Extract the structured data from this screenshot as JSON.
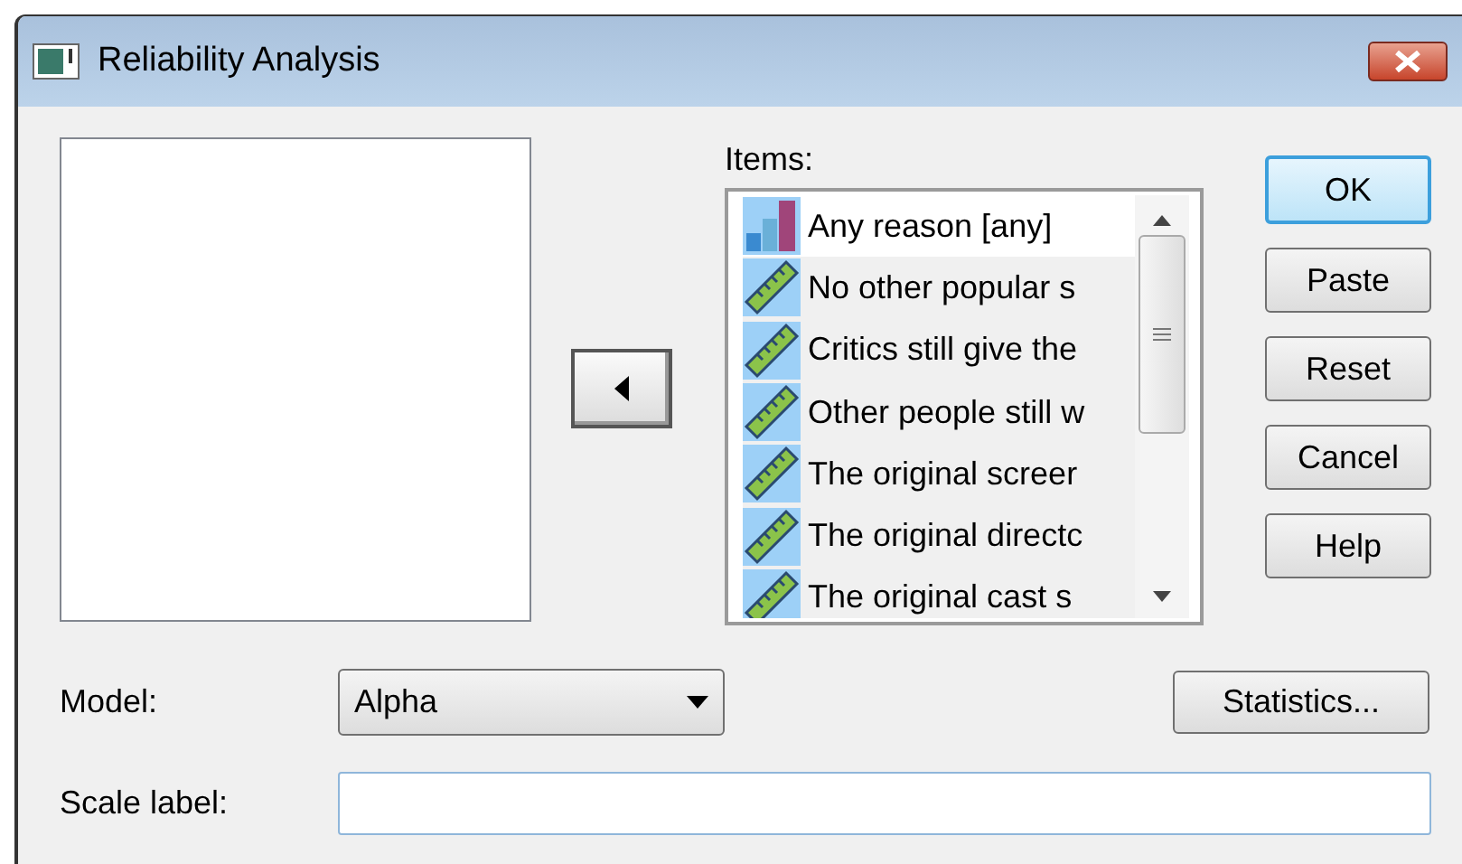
{
  "window": {
    "title": "Reliability Analysis"
  },
  "items_label": "Items:",
  "items": [
    {
      "kind": "nominal",
      "label": "Any reason [any]"
    },
    {
      "kind": "scale",
      "label": "No other popular s"
    },
    {
      "kind": "scale",
      "label": "Critics still give the"
    },
    {
      "kind": "scale",
      "label": "Other people still w"
    },
    {
      "kind": "scale",
      "label": "The original screer"
    },
    {
      "kind": "scale",
      "label": "The original directc"
    },
    {
      "kind": "scale",
      "label": "The original cast s"
    }
  ],
  "buttons": [
    {
      "label": "OK",
      "default": true
    },
    {
      "label": "Paste",
      "default": false
    },
    {
      "label": "Reset",
      "default": false
    },
    {
      "label": "Cancel",
      "default": false
    },
    {
      "label": "Help",
      "default": false
    }
  ],
  "model": {
    "label": "Model:",
    "value": "Alpha"
  },
  "statistics_button": "Statistics...",
  "scale_label": {
    "label": "Scale label:"
  }
}
